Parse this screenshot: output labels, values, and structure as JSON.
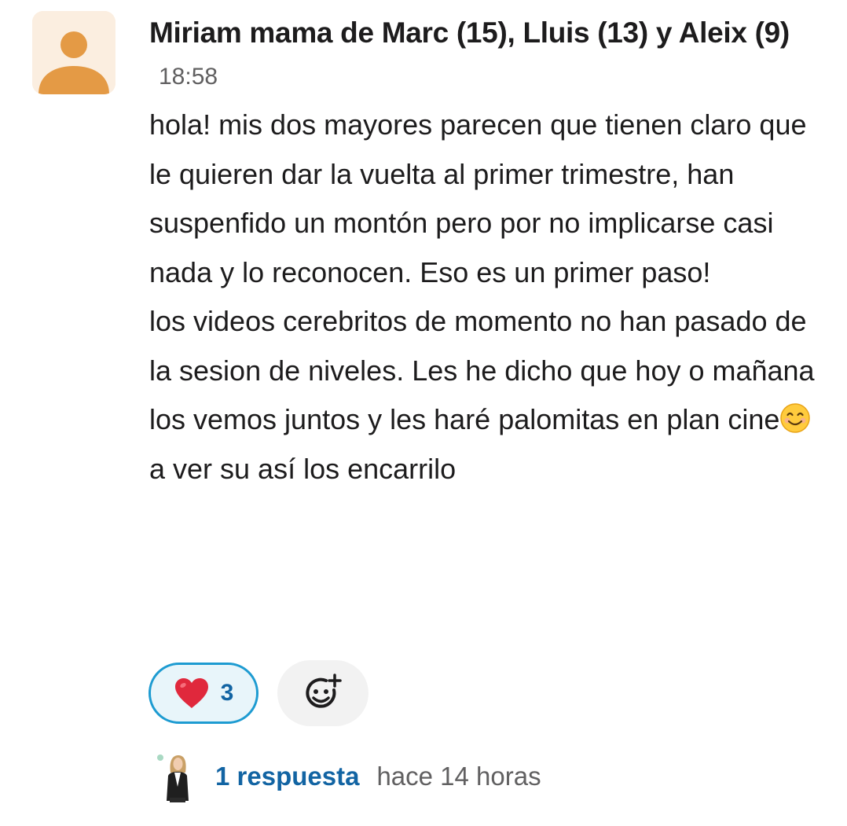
{
  "message": {
    "sender": "Miriam mama de Marc (15), Lluis (13) y Aleix (9)",
    "time": "18:58",
    "paragraph1": "hola! mis dos mayores parecen que tienen claro que le quieren dar la vuelta al primer trimestre, han suspenfido un montón pero por no implicarse casi nada y lo reconocen. Eso es un primer paso!",
    "paragraph2_before_emoji": "los videos cerebritos de momento no han pasado de la sesion de niveles. Les he dicho que hoy o mañana los vemos juntos  y les haré palomitas en plan cine",
    "paragraph2_after_emoji": " a ver su así los encarrilo",
    "inline_emoji": "smiling-face-emoji"
  },
  "reactions": [
    {
      "emoji": "heart-icon",
      "count": "3",
      "active": true
    }
  ],
  "add_reaction": {
    "icon": "add-emoji-icon"
  },
  "thread": {
    "reply_count_label": "1 respuesta",
    "last_reply": "hace 14 horas"
  },
  "colors": {
    "avatar_bg": "#fbeee0",
    "avatar_fg": "#e49a45",
    "link": "#1264a3",
    "reaction_border": "#1d9bd1",
    "reaction_bg": "#e8f5fa",
    "heart": "#e0283c"
  }
}
